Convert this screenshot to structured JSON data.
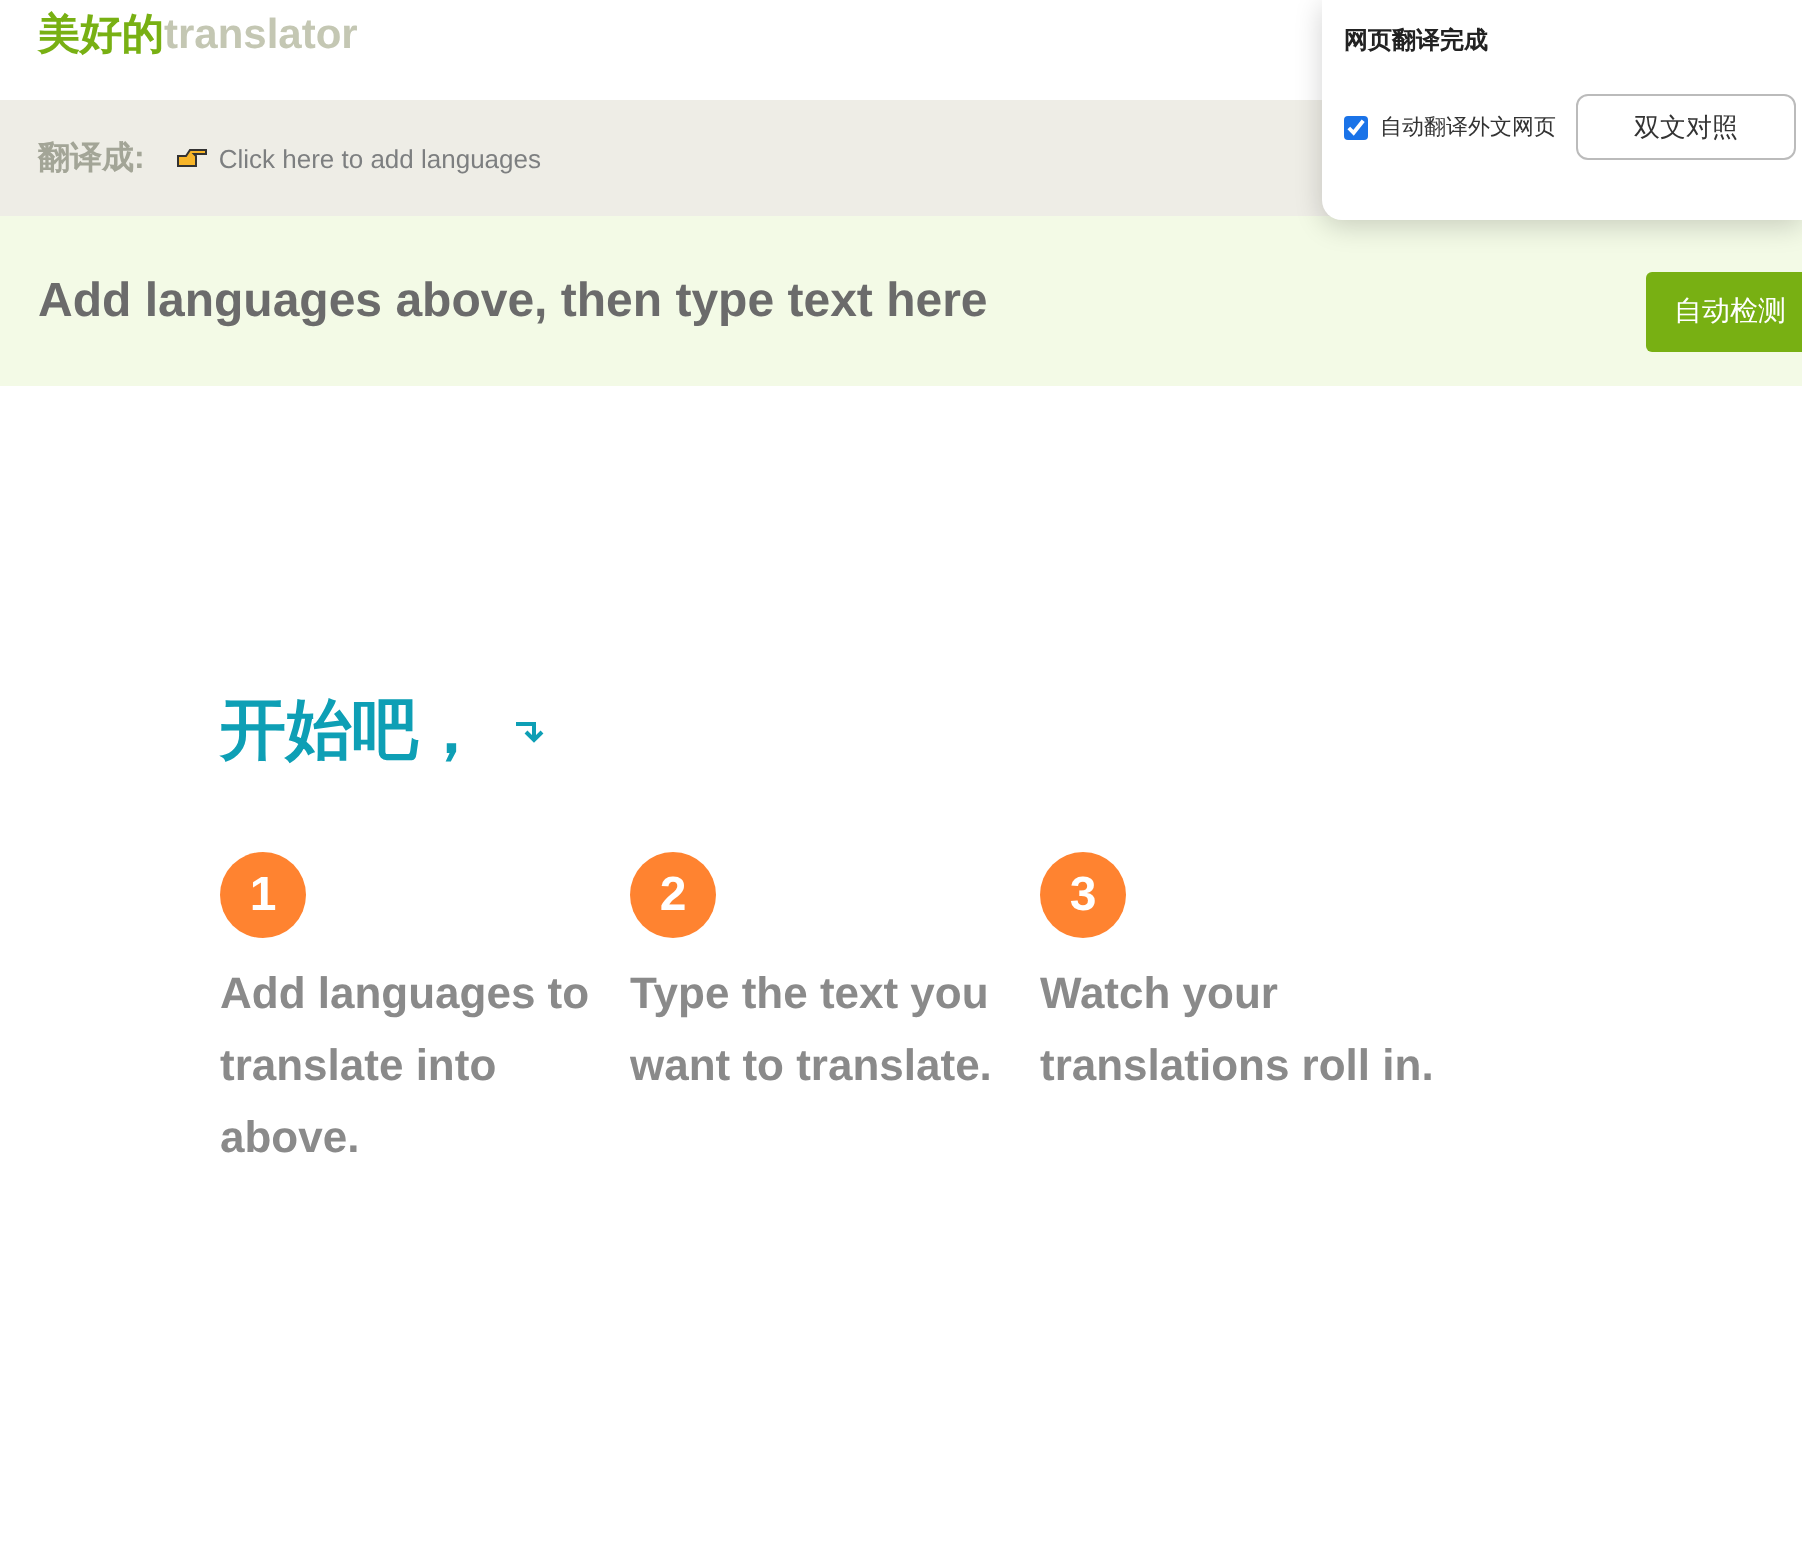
{
  "header": {
    "logo_cjk": "美好的",
    "logo_latin": "translator"
  },
  "language_bar": {
    "label": "翻译成:",
    "add_link": "Click here to add languages"
  },
  "input_bar": {
    "placeholder": "Add languages above, then type text here",
    "detect_button": "自动检测"
  },
  "intro": {
    "heading": "开始吧，",
    "steps": [
      {
        "number": "1",
        "text": "Add languages to translate into above."
      },
      {
        "number": "2",
        "text": "Type the text you want to translate."
      },
      {
        "number": "3",
        "text": "Watch your translations roll in."
      }
    ]
  },
  "translate_popup": {
    "title": "网页翻译完成",
    "auto_translate": {
      "label": "自动翻译外文网页",
      "checked": true
    },
    "bilingual_button": "双文对照"
  }
}
